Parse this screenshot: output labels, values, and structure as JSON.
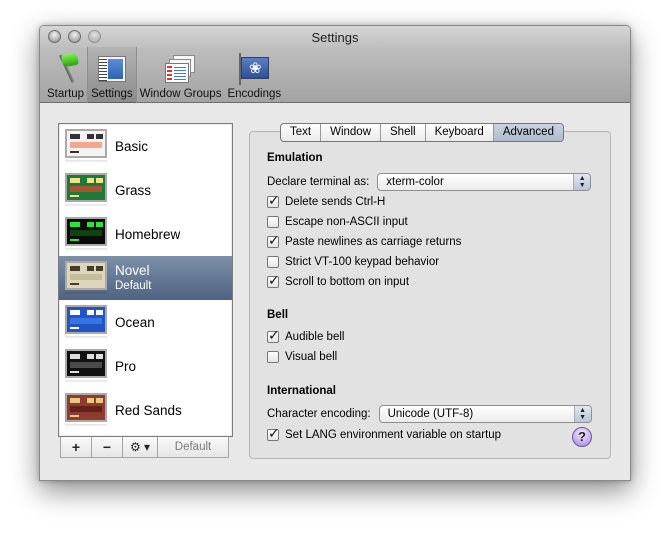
{
  "window": {
    "title": "Settings",
    "traffic_lights": [
      "close",
      "minimize",
      "zoom"
    ]
  },
  "toolbar": {
    "items": [
      {
        "label": "Startup",
        "icon": "startup-flag-icon",
        "selected": false
      },
      {
        "label": "Settings",
        "icon": "settings-icon",
        "selected": true
      },
      {
        "label": "Window Groups",
        "icon": "window-groups-icon",
        "selected": false
      },
      {
        "label": "Encodings",
        "icon": "encodings-icon",
        "selected": false
      }
    ]
  },
  "profiles": {
    "items": [
      {
        "name": "Basic",
        "sub": "",
        "selected": false,
        "bg": "#f4f4f4",
        "band": "#f29a78",
        "fg": "#333333"
      },
      {
        "name": "Grass",
        "sub": "",
        "selected": false,
        "bg": "#1f7a3a",
        "band": "#c0502e",
        "fg": "#f2e08a"
      },
      {
        "name": "Homebrew",
        "sub": "",
        "selected": false,
        "bg": "#0a0a0a",
        "band": "#124d12",
        "fg": "#2fe62f"
      },
      {
        "name": "Novel",
        "sub": "Default",
        "selected": true,
        "bg": "#ddd6bd",
        "band": "#c2b998",
        "fg": "#4a3a2a"
      },
      {
        "name": "Ocean",
        "sub": "",
        "selected": false,
        "bg": "#2255c4",
        "band": "#3b7be8",
        "fg": "#ffffff"
      },
      {
        "name": "Pro",
        "sub": "",
        "selected": false,
        "bg": "#111111",
        "band": "#555555",
        "fg": "#dddddd"
      },
      {
        "name": "Red Sands",
        "sub": "",
        "selected": false,
        "bg": "#8e3b30",
        "band": "#5a1f18",
        "fg": "#e8c87a"
      }
    ],
    "controls": {
      "add": "+",
      "remove": "−",
      "gear": "⚙ ▾",
      "default": "Default"
    }
  },
  "tabs": {
    "items": [
      "Text",
      "Window",
      "Shell",
      "Keyboard",
      "Advanced"
    ],
    "active": "Advanced"
  },
  "emulation": {
    "heading": "Emulation",
    "declare_label": "Declare terminal as:",
    "declare_value": "xterm-color",
    "options": [
      {
        "label": "Delete sends Ctrl-H",
        "checked": true
      },
      {
        "label": "Escape non-ASCII input",
        "checked": false
      },
      {
        "label": "Paste newlines as carriage returns",
        "checked": true
      },
      {
        "label": "Strict VT-100 keypad behavior",
        "checked": false
      },
      {
        "label": "Scroll to bottom on input",
        "checked": true
      }
    ]
  },
  "bell": {
    "heading": "Bell",
    "options": [
      {
        "label": "Audible bell",
        "checked": true
      },
      {
        "label": "Visual bell",
        "checked": false
      }
    ]
  },
  "international": {
    "heading": "International",
    "encoding_label": "Character encoding:",
    "encoding_value": "Unicode (UTF-8)",
    "lang_option": {
      "label": "Set LANG environment variable on startup",
      "checked": true
    },
    "help": "?"
  }
}
